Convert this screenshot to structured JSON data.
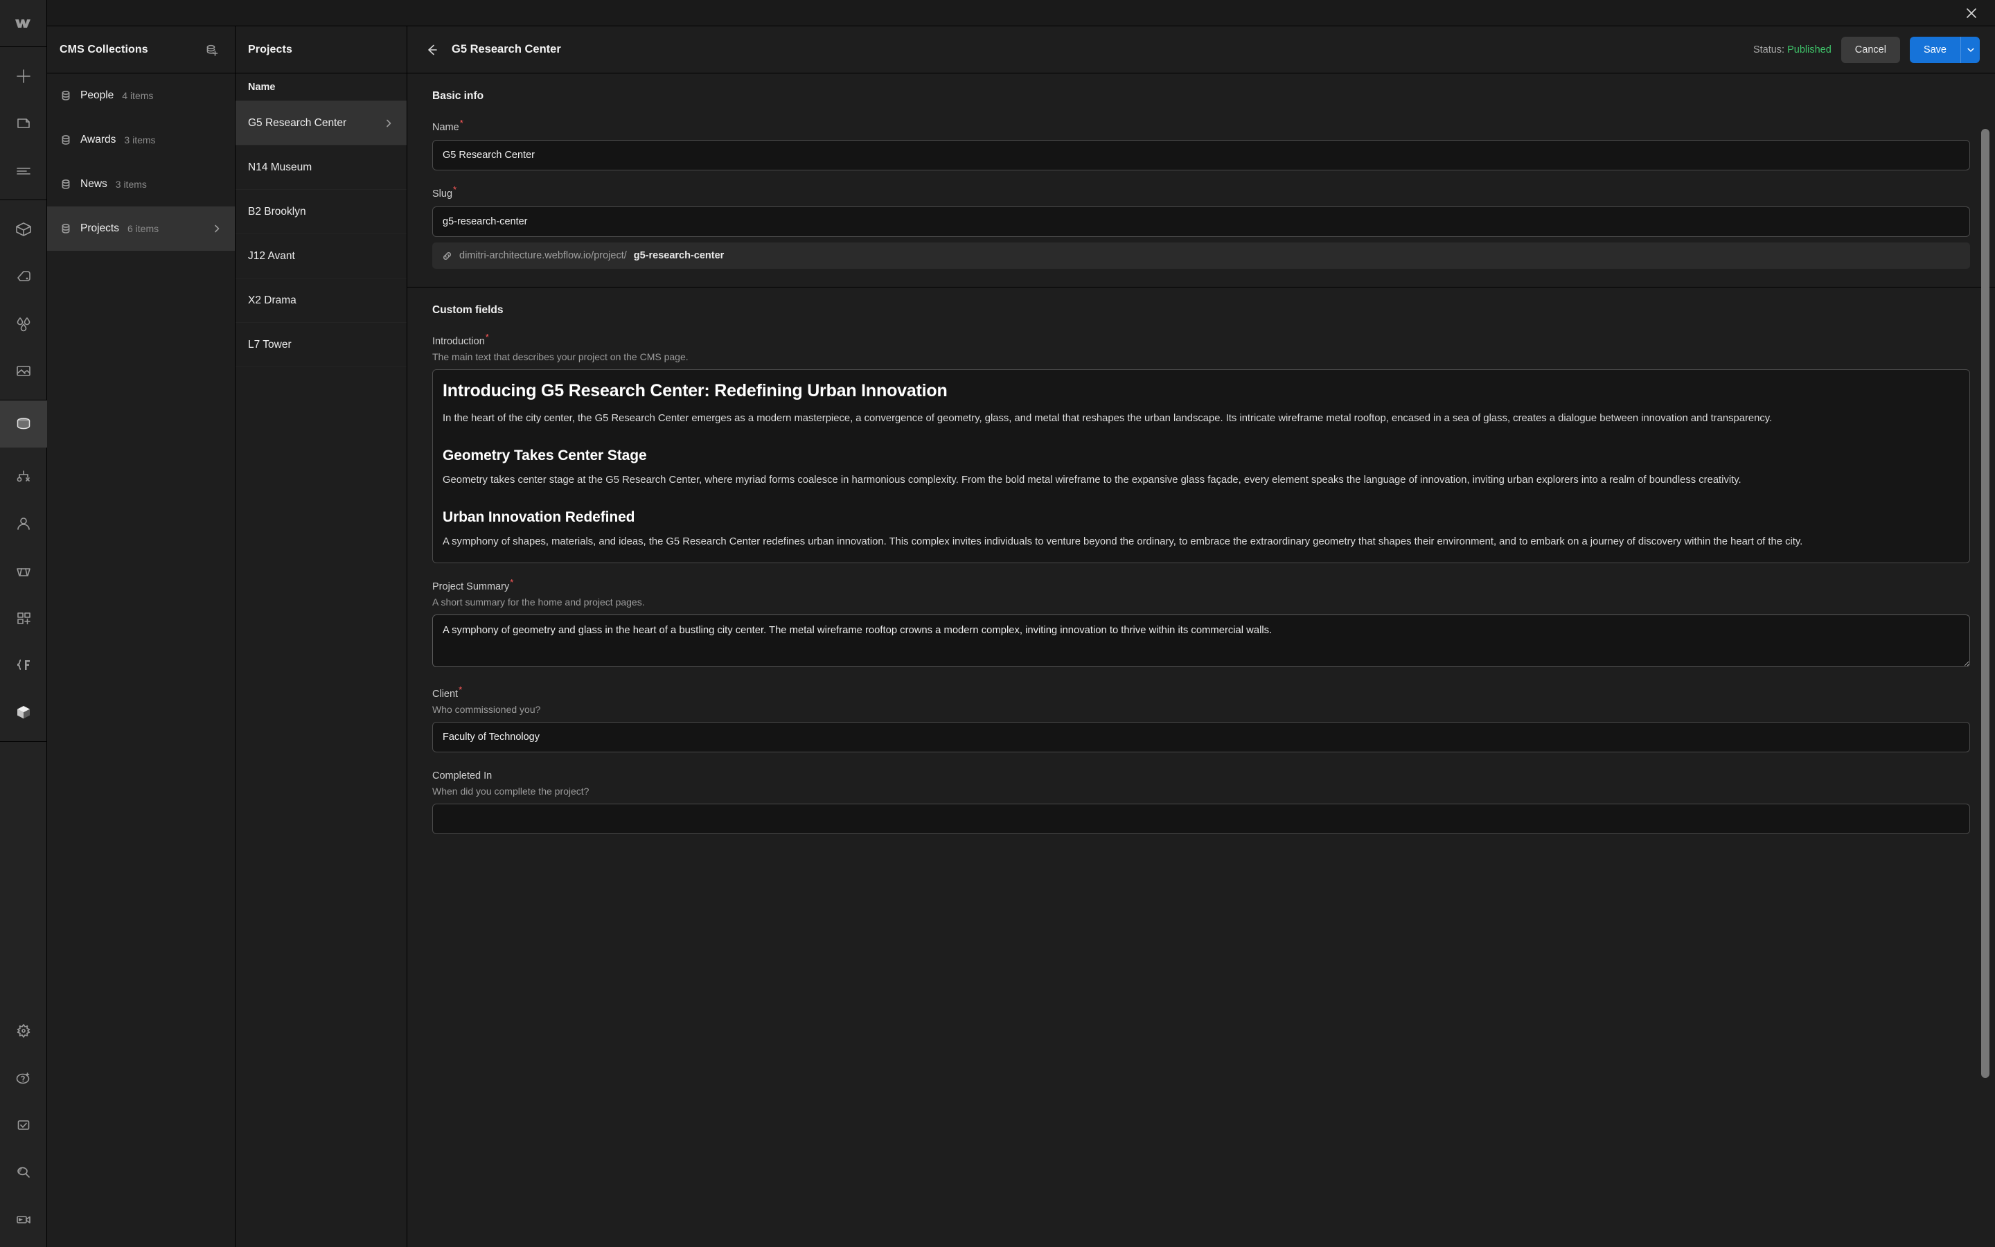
{
  "window": {
    "close_label": "×"
  },
  "rail": {
    "logo": "webflow-logo",
    "items": [
      {
        "name": "add-element",
        "icon": "plus-icon"
      },
      {
        "name": "pages",
        "icon": "page-icon"
      },
      {
        "name": "navigator",
        "icon": "navigator-icon"
      },
      {
        "name": "components",
        "icon": "cube-icon"
      },
      {
        "name": "style-selector",
        "icon": "paint-icon"
      },
      {
        "name": "variables",
        "icon": "drops-icon"
      },
      {
        "name": "assets",
        "icon": "image-icon"
      },
      {
        "name": "cms",
        "icon": "database-icon"
      },
      {
        "name": "logic",
        "icon": "logic-icon"
      },
      {
        "name": "users",
        "icon": "user-icon"
      },
      {
        "name": "ecommerce",
        "icon": "basket-icon"
      },
      {
        "name": "apps",
        "icon": "apps-plus-icon"
      },
      {
        "name": "code",
        "icon": "code-brace-icon"
      },
      {
        "name": "libraries",
        "icon": "cube-solid-icon"
      }
    ],
    "bottom_items": [
      {
        "name": "settings",
        "icon": "gear-icon"
      },
      {
        "name": "help",
        "icon": "question-sparkle-icon"
      },
      {
        "name": "audit",
        "icon": "checkbox-icon"
      },
      {
        "name": "search",
        "icon": "search-icon"
      },
      {
        "name": "video",
        "icon": "video-icon"
      }
    ]
  },
  "collections_panel": {
    "title": "CMS Collections",
    "add_icon": "add-collection-icon",
    "items": [
      {
        "label": "People",
        "count": "4 items",
        "selected": false
      },
      {
        "label": "Awards",
        "count": "3 items",
        "selected": false
      },
      {
        "label": "News",
        "count": "3 items",
        "selected": false
      },
      {
        "label": "Projects",
        "count": "6 items",
        "selected": true
      }
    ]
  },
  "items_panel": {
    "title": "Projects",
    "column_header": "Name",
    "rows": [
      {
        "label": "G5 Research Center",
        "selected": true
      },
      {
        "label": "N14 Museum",
        "selected": false
      },
      {
        "label": "B2 Brooklyn",
        "selected": false
      },
      {
        "label": "J12 Avant",
        "selected": false
      },
      {
        "label": "X2 Drama",
        "selected": false
      },
      {
        "label": "L7 Tower",
        "selected": false
      }
    ]
  },
  "editor": {
    "back_icon": "arrow-left-icon",
    "title": "G5 Research Center",
    "status_label": "Status:",
    "status_value": "Published",
    "status_color": "#3fc46a",
    "cancel_label": "Cancel",
    "save_label": "Save",
    "save_caret_icon": "chevron-down-icon",
    "save_color": "#1673d9",
    "basic_info": {
      "section_title": "Basic info",
      "name": {
        "label": "Name",
        "required": true,
        "value": "G5 Research Center"
      },
      "slug": {
        "label": "Slug",
        "required": true,
        "value": "g5-research-center",
        "preview_icon": "link-icon",
        "preview_prefix": "dimitri-architecture.webflow.io/project/",
        "preview_slug": "g5-research-center"
      }
    },
    "custom_fields": {
      "section_title": "Custom fields",
      "introduction": {
        "label": "Introduction",
        "required": true,
        "help": "The main text that describes your project on the CMS page.",
        "blocks": [
          {
            "type": "h2",
            "text": "Introducing G5 Research Center: Redefining Urban Innovation"
          },
          {
            "type": "p",
            "text": "In the heart of the city center, the G5 Research Center emerges as a modern masterpiece, a convergence of geometry, glass, and metal that reshapes the urban landscape. Its intricate wireframe metal rooftop, encased in a sea of glass, creates a dialogue between innovation and transparency."
          },
          {
            "type": "h3",
            "text": "Geometry Takes Center Stage"
          },
          {
            "type": "p",
            "text": "Geometry takes center stage at the G5 Research Center, where myriad forms coalesce in harmonious complexity. From the bold metal wireframe to the expansive glass façade, every element speaks the language of innovation, inviting urban explorers into a realm of boundless creativity."
          },
          {
            "type": "h3",
            "text": "Urban Innovation Redefined"
          },
          {
            "type": "p",
            "text": "A symphony of shapes, materials, and ideas, the G5 Research Center redefines urban innovation. This complex invites individuals to venture beyond the ordinary, to embrace the extraordinary geometry that shapes their environment, and to embark on a journey of discovery within the heart of the city."
          }
        ]
      },
      "project_summary": {
        "label": "Project Summary",
        "required": true,
        "help": "A short summary for the home and project pages.",
        "value": "A symphony of geometry and glass in the heart of a bustling city center. The metal wireframe rooftop crowns a modern complex, inviting innovation to thrive within its commercial walls."
      },
      "client": {
        "label": "Client",
        "required": true,
        "help": "Who commissioned you?",
        "value": "Faculty of Technology"
      },
      "completed_in": {
        "label": "Completed In",
        "required": false,
        "help": "When did you compllete the project?",
        "value": ""
      }
    }
  }
}
